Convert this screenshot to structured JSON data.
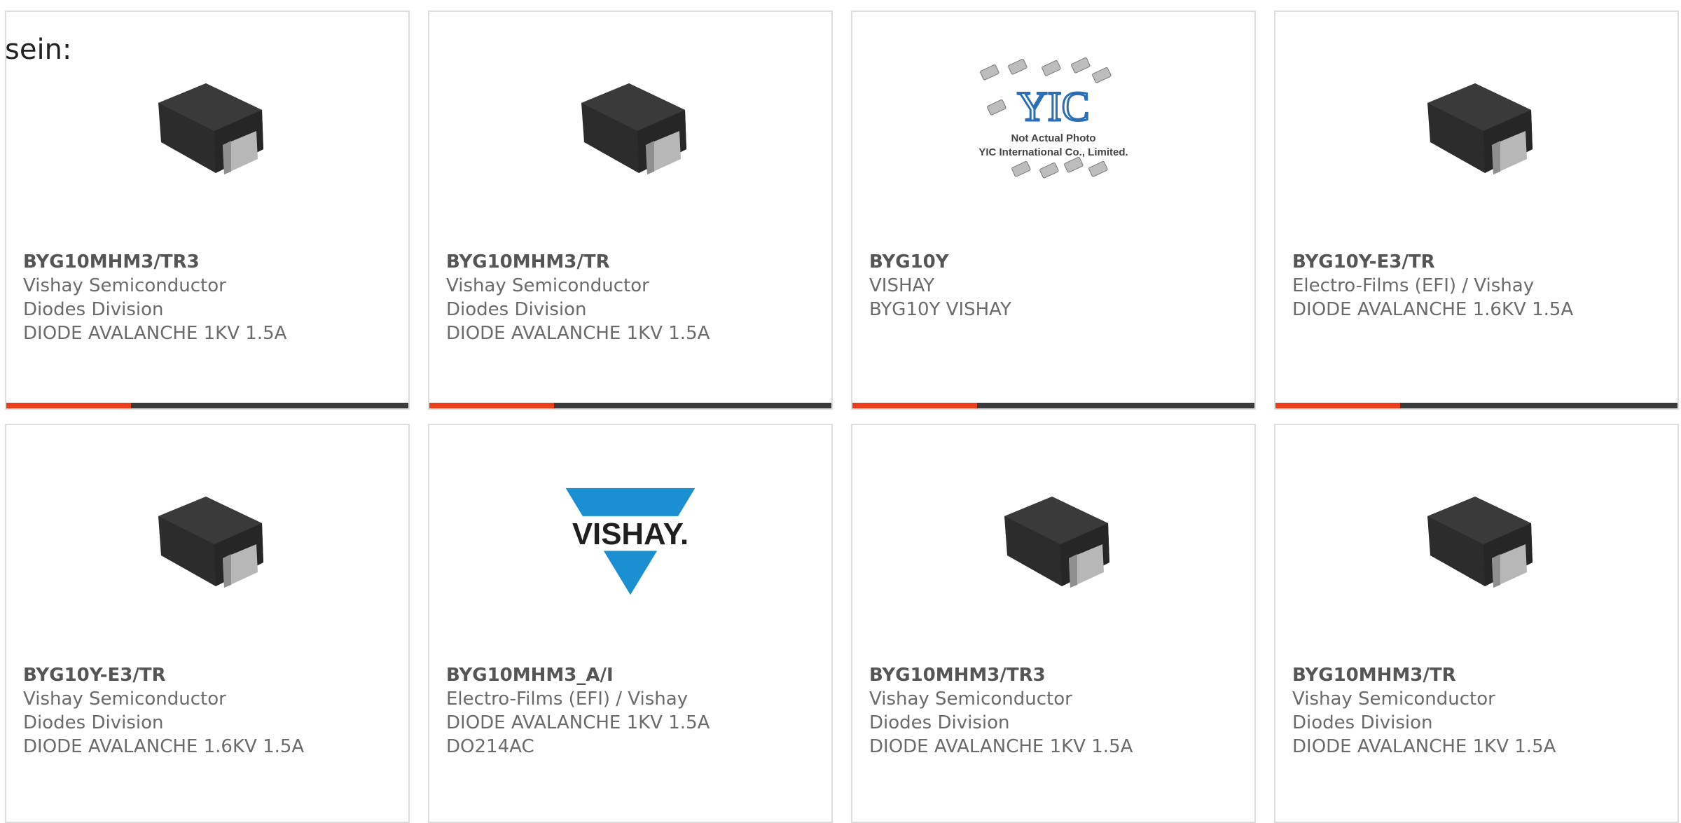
{
  "intro_text": "sein:",
  "accent_color": "#e8401c",
  "cards": [
    {
      "part": "BYG10MHM3/TR3",
      "manufacturer": "Vishay Semiconductor Diodes Division",
      "lines": [
        "DIODE AVALANCHE 1KV 1.5A"
      ],
      "image": "smd-diode-package",
      "progress": 0.31
    },
    {
      "part": "BYG10MHM3/TR",
      "manufacturer": "Vishay Semiconductor Diodes Division",
      "lines": [
        "DIODE AVALANCHE 1KV 1.5A"
      ],
      "image": "smd-diode-package",
      "progress": 0.31
    },
    {
      "part": "BYG10Y",
      "manufacturer": "VISHAY",
      "lines": [
        "BYG10Y VISHAY"
      ],
      "image": "yic-placeholder",
      "image_text": [
        "Not Actual Photo",
        "YIC International Co., Limited."
      ],
      "logo_text": "YIC",
      "progress": 0.31
    },
    {
      "part": "BYG10Y-E3/TR",
      "manufacturer": "Electro-Films (EFI) / Vishay",
      "lines": [
        "DIODE AVALANCHE 1.6KV 1.5A"
      ],
      "image": "smd-diode-package",
      "progress": 0.31
    },
    {
      "part": "BYG10Y-E3/TR",
      "manufacturer": "Vishay Semiconductor Diodes Division",
      "lines": [
        "DIODE AVALANCHE 1.6KV 1.5A"
      ],
      "image": "smd-diode-package"
    },
    {
      "part": "BYG10MHM3_A/I",
      "manufacturer": "Electro-Films (EFI) / Vishay",
      "lines": [
        "DIODE AVALANCHE 1KV 1.5A",
        "DO214AC"
      ],
      "image": "vishay-logo",
      "logo_text": "VISHAY."
    },
    {
      "part": "BYG10MHM3/TR3",
      "manufacturer": "Vishay Semiconductor Diodes Division",
      "lines": [
        "DIODE AVALANCHE 1KV 1.5A"
      ],
      "image": "smd-diode-package"
    },
    {
      "part": "BYG10MHM3/TR",
      "manufacturer": "Vishay Semiconductor Diodes Division",
      "lines": [
        "DIODE AVALANCHE 1KV 1.5A"
      ],
      "image": "smd-diode-package"
    }
  ]
}
